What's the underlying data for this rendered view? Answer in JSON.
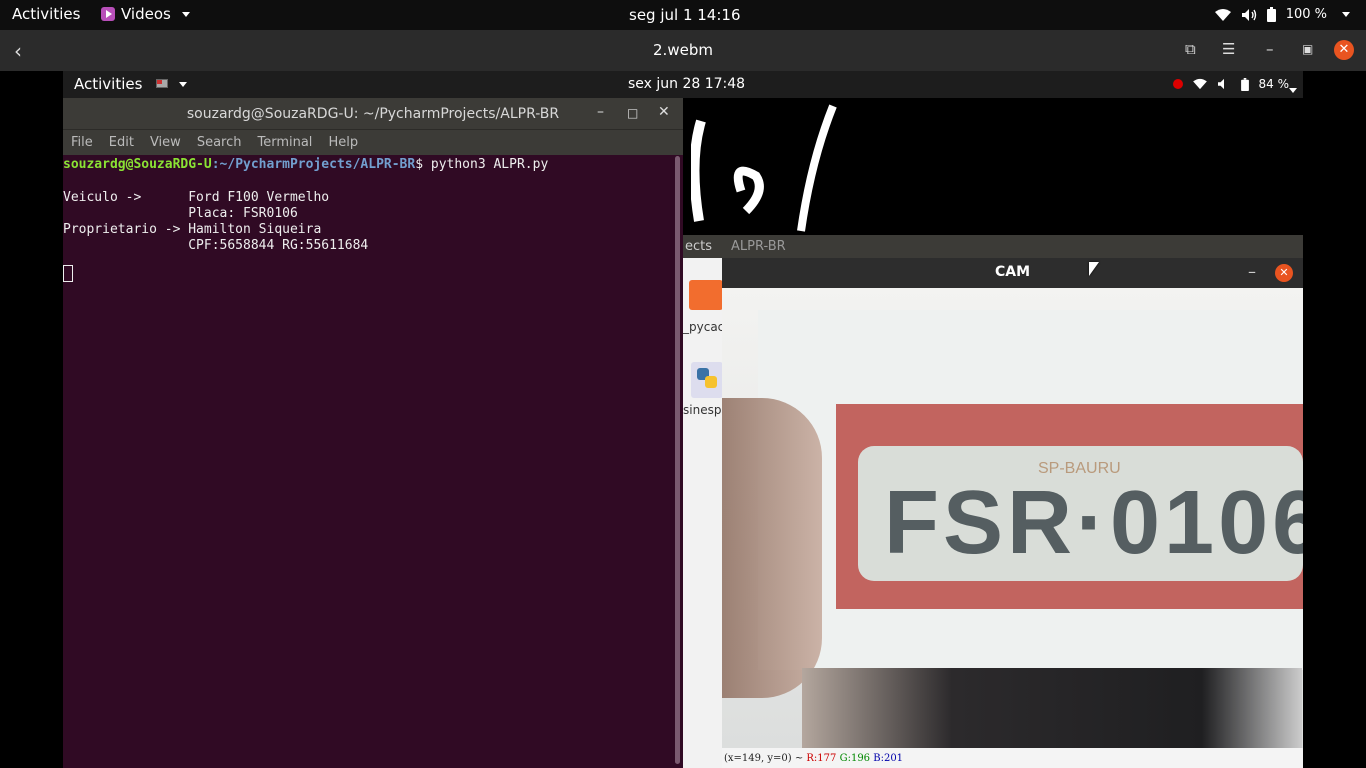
{
  "host": {
    "topbar": {
      "activities": "Activities",
      "app_name": "Videos",
      "clock": "seg jul 1  14:16",
      "battery": "100 %"
    },
    "player": {
      "title": "2.webm"
    }
  },
  "video": {
    "topbar": {
      "activities": "Activities",
      "clock": "sex jun 28  17:48",
      "battery": "84 %"
    },
    "terminal": {
      "title": "souzardg@SouzaRDG-U: ~/PycharmProjects/ALPR-BR",
      "menu": [
        "File",
        "Edit",
        "View",
        "Search",
        "Terminal",
        "Help"
      ],
      "prompt_user": "souzardg@SouzaRDG-U",
      "prompt_path": ":~/PycharmProjects/ALPR-BR",
      "command": "$ python3 ALPR.py",
      "output": [
        "Veiculo ->      Ford F100 Vermelho",
        "                Placa: FSR0106",
        "Proprietario -> Hamilton Siqueira",
        "                CPF:5658844 RG:55611684"
      ]
    },
    "files_window": {
      "path_start": "ects",
      "path_current": "ALPR-BR",
      "folder_label": "_pycac",
      "file_label": "sinesp."
    },
    "cam_window": {
      "title": "CAM",
      "plate_state": "SP-BAURU",
      "plate_number": "FSR·0106",
      "status_coords": "(x=149, y=0) ~ ",
      "status_r": "R:177",
      "status_g": "G:196",
      "status_b": "B:201"
    }
  }
}
